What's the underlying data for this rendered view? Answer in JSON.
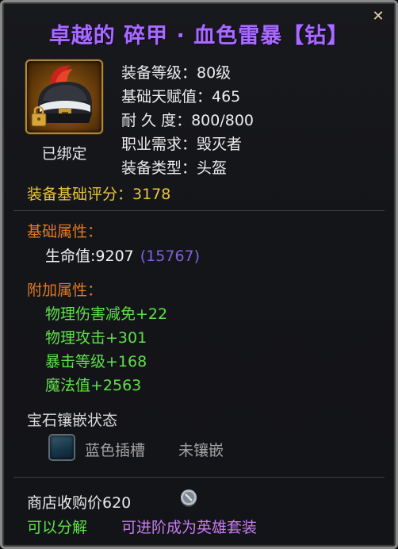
{
  "item": {
    "title": "卓越的 碎甲 · 血色雷暴【钻】",
    "bound_label": "已绑定",
    "icon": "helmet-icon",
    "stats": [
      {
        "text": "装备等级：80级"
      },
      {
        "text": "基础天赋值：465"
      },
      {
        "text": "耐 久 度：800/800"
      },
      {
        "text": "职业需求：毁灭者"
      },
      {
        "text": "装备类型：头盔"
      }
    ],
    "score": "装备基础评分：3178",
    "base_attr_title": "基础属性：",
    "hp_text": "生命值:9207",
    "hp_bonus": "(15767)",
    "extra_attr_title": "附加属性：",
    "extra_attrs": [
      {
        "text": "物理伤害减免+22"
      },
      {
        "text": "物理攻击+301"
      },
      {
        "text": "暴击等级+168"
      },
      {
        "text": "魔法值+2563"
      }
    ],
    "gem_title": "宝石镶嵌状态",
    "gem_slot": {
      "type": "蓝色插槽",
      "status": "未镶嵌"
    },
    "shop_price": "商店收购价620",
    "coin_icon": "silver-coin-icon",
    "decompose": "可以分解",
    "upgrade": "可进阶成为英雄套装"
  },
  "close_icon": "close-icon",
  "colors": {
    "title": "#a86bff",
    "score": "#e8c43c",
    "section": "#e07a22",
    "green": "#5fe04a",
    "purple_bonus": "#8062d8",
    "upgrade": "#c57cf0"
  }
}
